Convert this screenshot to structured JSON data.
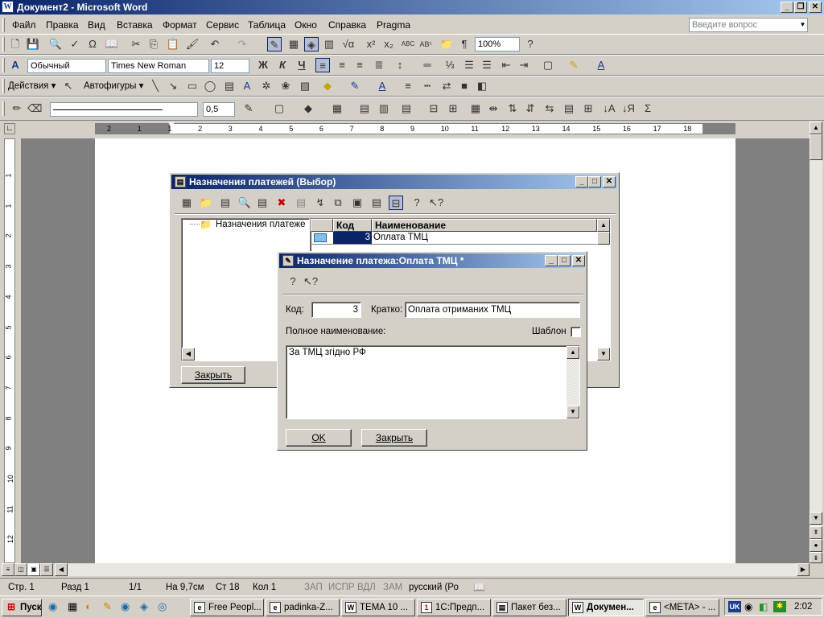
{
  "window": {
    "title": "Документ2 - Microsoft Word",
    "icon_letter": "W"
  },
  "menu": {
    "items": [
      "Файл",
      "Правка",
      "Вид",
      "Вставка",
      "Формат",
      "Сервис",
      "Таблица",
      "Окно",
      "Справка",
      "Pragma"
    ],
    "ask_placeholder": "Введите вопрос"
  },
  "toolbar_std": {
    "zoom": "100%"
  },
  "toolbar_fmt": {
    "style": "Обычный",
    "font": "Times New Roman",
    "size": "12",
    "bold": "Ж",
    "italic": "К",
    "underline": "Ч"
  },
  "toolbar_draw": {
    "actions": "Действия",
    "autoshapes": "Автофигуры"
  },
  "toolbar_tables": {
    "line_weight": "0,5"
  },
  "ruler": {
    "ticks": [
      "2",
      "1",
      "1",
      "2",
      "3",
      "4",
      "5",
      "6",
      "7",
      "8",
      "9",
      "10",
      "11",
      "12",
      "13",
      "14",
      "15",
      "16",
      "17",
      "18"
    ]
  },
  "vruler": {
    "ticks": [
      "1",
      "1",
      "2",
      "3",
      "4",
      "5",
      "6",
      "7",
      "8",
      "9",
      "10",
      "11",
      "12",
      "13"
    ]
  },
  "status": {
    "page": "Стр. 1",
    "section": "Разд 1",
    "pages": "1/1",
    "at": "На 9,7см",
    "line": "Ст 18",
    "col": "Кол 1",
    "rec": "ЗАП",
    "trk": "ИСПР",
    "ext": "ВДЛ",
    "ovr": "ЗАМ",
    "lang": "русский (Ро"
  },
  "taskbar": {
    "start": "Пуск",
    "tasks": [
      "Free Peopl...",
      "padinka-Z...",
      "TEMA 10 ...",
      "1С:Предп...",
      "Пакет без...",
      "Докумен...",
      "<META> - ..."
    ],
    "active_index": 5,
    "clock": "2:02",
    "lang": "UK"
  },
  "dialog_list": {
    "title": "Назначения платежей (Выбор)",
    "tree_root": "Назначения платеже",
    "columns": [
      "Код",
      "Наименование"
    ],
    "rows": [
      {
        "code": "3",
        "name": "Оплата ТМЦ"
      }
    ],
    "close_button": "Закрыть"
  },
  "dialog_edit": {
    "title": "Назначение платежа:Оплата ТМЦ *",
    "code_label": "Код:",
    "code_value": "3",
    "short_label": "Кратко:",
    "short_value": "Оплата отриманих ТМЦ",
    "full_label": "Полное наименование:",
    "template_label": "Шаблон",
    "template_checked": false,
    "full_value": "За ТМЦ згідно РФ",
    "ok_button": "OK",
    "close_button": "Закрыть"
  }
}
